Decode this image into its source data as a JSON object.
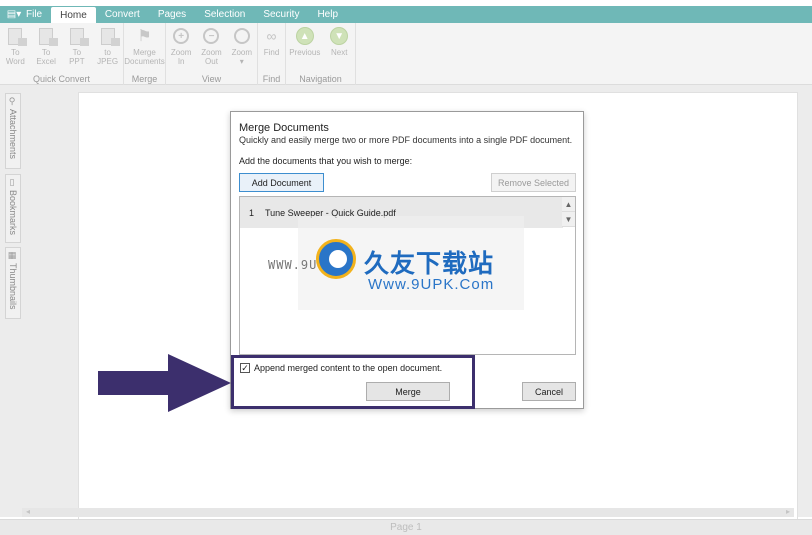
{
  "menubar": {
    "items": [
      {
        "label": "File"
      },
      {
        "label": "Home"
      },
      {
        "label": "Convert"
      },
      {
        "label": "Pages"
      },
      {
        "label": "Selection"
      },
      {
        "label": "Security"
      },
      {
        "label": "Help"
      }
    ],
    "active": "Home"
  },
  "ribbon": {
    "quick_convert": {
      "name": "Quick Convert",
      "buttons": [
        {
          "line1": "To",
          "line2": "Word"
        },
        {
          "line1": "To",
          "line2": "Excel"
        },
        {
          "line1": "To",
          "line2": "PPT"
        },
        {
          "line1": "to",
          "line2": "JPEG"
        }
      ]
    },
    "merge": {
      "name": "Merge",
      "button": {
        "line1": "Merge",
        "line2": "Documents"
      }
    },
    "view": {
      "name": "View",
      "buttons": [
        {
          "line1": "Zoom",
          "line2": "In"
        },
        {
          "line1": "Zoom",
          "line2": "Out"
        },
        {
          "line1": "Zoom",
          "line2": "▾"
        }
      ]
    },
    "find": {
      "name": "Find",
      "button": {
        "line1": "Find",
        "line2": ""
      }
    },
    "navigation": {
      "name": "Navigation",
      "buttons": [
        {
          "line1": "Previous",
          "line2": ""
        },
        {
          "line1": "Next",
          "line2": ""
        }
      ]
    }
  },
  "sidepanel": {
    "tabs": [
      {
        "label": "Attachments",
        "icon": "paperclip-icon"
      },
      {
        "label": "Bookmarks",
        "icon": "bookmark-icon"
      },
      {
        "label": "Thumbnails",
        "icon": "thumbnails-icon"
      }
    ]
  },
  "status": {
    "page": "Page 1"
  },
  "dialog": {
    "title": "Merge Documents",
    "subtitle": "Quickly and easily merge two or more PDF documents into a single PDF document.",
    "instruction": "Add the documents that you wish to merge:",
    "add_button": "Add Document",
    "remove_button": "Remove Selected",
    "documents": [
      {
        "index": "1",
        "name": "Tune Sweeper - Quick Guide.pdf"
      }
    ],
    "append_checkbox": {
      "label": "Append merged content to the open document.",
      "checked": true
    },
    "merge_button": "Merge",
    "cancel_button": "Cancel"
  },
  "watermark": {
    "cn": "久友下载站",
    "www": "WWW.9U",
    "url": "Www.9UPK.Com"
  },
  "colors": {
    "menubar": "#6fb8b7",
    "annotation": "#3c2f6d",
    "primary_border": "#3d8ecf"
  }
}
